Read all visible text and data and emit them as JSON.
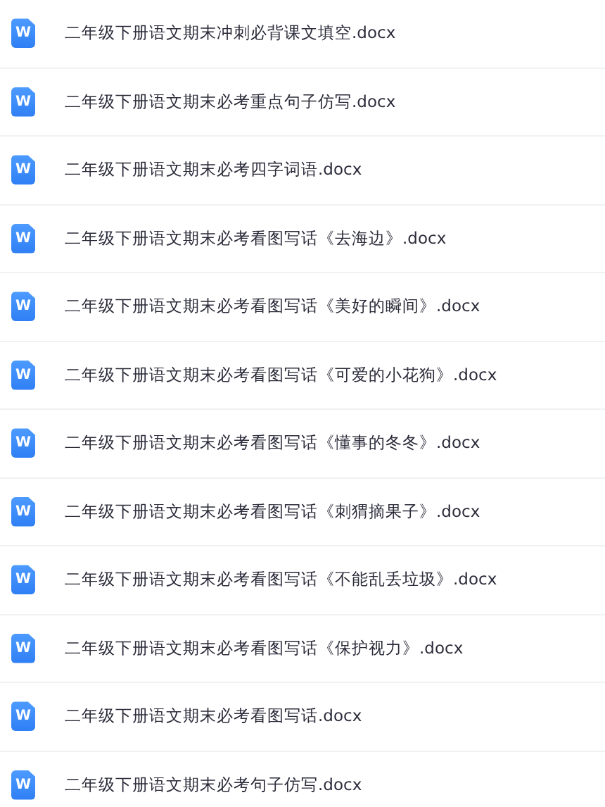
{
  "files": [
    {
      "name": "二年级下册语文期末冲刺必背课文填空.docx",
      "icon_letter": "W"
    },
    {
      "name": "二年级下册语文期末必考重点句子仿写.docx",
      "icon_letter": "W"
    },
    {
      "name": "二年级下册语文期末必考四字词语.docx",
      "icon_letter": "W"
    },
    {
      "name": "二年级下册语文期末必考看图写话《去海边》.docx",
      "icon_letter": "W"
    },
    {
      "name": "二年级下册语文期末必考看图写话《美好的瞬间》.docx",
      "icon_letter": "W"
    },
    {
      "name": "二年级下册语文期末必考看图写话《可爱的小花狗》.docx",
      "icon_letter": "W"
    },
    {
      "name": "二年级下册语文期末必考看图写话《懂事的冬冬》.docx",
      "icon_letter": "W"
    },
    {
      "name": "二年级下册语文期末必考看图写话《刺猬摘果子》.docx",
      "icon_letter": "W"
    },
    {
      "name": "二年级下册语文期末必考看图写话《不能乱丢垃圾》.docx",
      "icon_letter": "W"
    },
    {
      "name": "二年级下册语文期末必考看图写话《保护视力》.docx",
      "icon_letter": "W"
    },
    {
      "name": "二年级下册语文期末必考看图写话.docx",
      "icon_letter": "W"
    },
    {
      "name": "二年级下册语文期末必考句子仿写.docx",
      "icon_letter": "W"
    }
  ]
}
